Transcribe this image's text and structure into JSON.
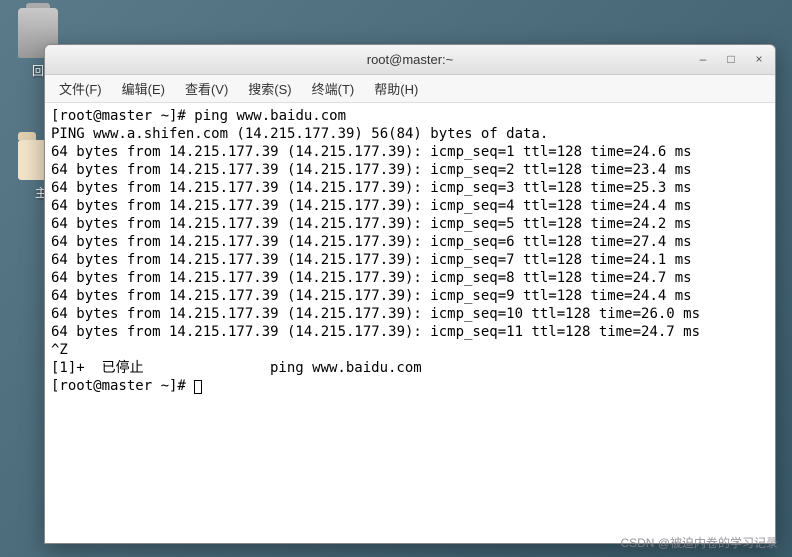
{
  "desktop": {
    "trash_label": "回",
    "home_label": "主"
  },
  "window": {
    "title": "root@master:~"
  },
  "menu": {
    "file": "文件(F)",
    "edit": "编辑(E)",
    "view": "查看(V)",
    "search": "搜索(S)",
    "terminal": "终端(T)",
    "help": "帮助(H)"
  },
  "terminal": {
    "prompt1": "[root@master ~]# ",
    "command1": "ping www.baidu.com",
    "header": "PING www.a.shifen.com (14.215.177.39) 56(84) bytes of data.",
    "lines": [
      "64 bytes from 14.215.177.39 (14.215.177.39): icmp_seq=1 ttl=128 time=24.6 ms",
      "64 bytes from 14.215.177.39 (14.215.177.39): icmp_seq=2 ttl=128 time=23.4 ms",
      "64 bytes from 14.215.177.39 (14.215.177.39): icmp_seq=3 ttl=128 time=25.3 ms",
      "64 bytes from 14.215.177.39 (14.215.177.39): icmp_seq=4 ttl=128 time=24.4 ms",
      "64 bytes from 14.215.177.39 (14.215.177.39): icmp_seq=5 ttl=128 time=24.2 ms",
      "64 bytes from 14.215.177.39 (14.215.177.39): icmp_seq=6 ttl=128 time=27.4 ms",
      "64 bytes from 14.215.177.39 (14.215.177.39): icmp_seq=7 ttl=128 time=24.1 ms",
      "64 bytes from 14.215.177.39 (14.215.177.39): icmp_seq=8 ttl=128 time=24.7 ms",
      "64 bytes from 14.215.177.39 (14.215.177.39): icmp_seq=9 ttl=128 time=24.4 ms",
      "64 bytes from 14.215.177.39 (14.215.177.39): icmp_seq=10 ttl=128 time=26.0 ms",
      "64 bytes from 14.215.177.39 (14.215.177.39): icmp_seq=11 ttl=128 time=24.7 ms"
    ],
    "suspend": "^Z",
    "job_status": "[1]+  已停止               ping www.baidu.com",
    "prompt2": "[root@master ~]# "
  },
  "watermark": "CSDN @被迫内卷的学习记录"
}
